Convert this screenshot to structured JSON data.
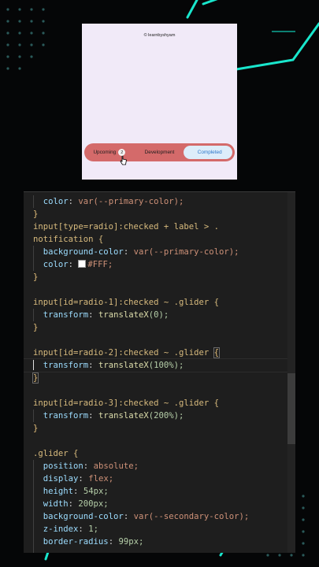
{
  "preview": {
    "brand": "© learnbyshyam",
    "tabs": [
      {
        "label": "Upcoming",
        "badge": "2"
      },
      {
        "label": "Development"
      },
      {
        "label": "Completed",
        "selected": true
      }
    ],
    "colors": {
      "bar": "#d46a6a",
      "glider": "#ddedfa",
      "background": "#f1eaf8"
    }
  },
  "code": {
    "l1_prop": "color",
    "l1_val": "var(--primary-color);",
    "l2": "}",
    "l3": "input[type=radio]:checked + label > .",
    "l4": "notification {",
    "l5_prop": "background-color",
    "l5_val": "var(--primary-color);",
    "l6_prop": "color",
    "l6_val": "#FFF;",
    "l7": "}",
    "l8": "input[id=radio-1]:checked ~ .glider {",
    "l9_prop": "transform",
    "l9_fn": "translateX",
    "l9_arg": "(0);",
    "l10": "}",
    "l11": "input[id=radio-2]:checked ~ .glider ",
    "l11_brace": "{",
    "l12_prop": "transform",
    "l12_fn": "translateX",
    "l12_arg": "(100%);",
    "l13": "}",
    "l14": "input[id=radio-3]:checked ~ .glider {",
    "l15_prop": "transform",
    "l15_fn": "translateX",
    "l15_arg": "(200%);",
    "l16": "}",
    "l17": ".glider {",
    "l18_prop": "position",
    "l18_val": "absolute;",
    "l19_prop": "display",
    "l19_val": "flex;",
    "l20_prop": "height",
    "l20_val": "54px;",
    "l21_prop": "width",
    "l21_val": "200px;",
    "l22_prop": "background-color",
    "l22_val": "var(--secondary-color);",
    "l23_prop": "z-index",
    "l23_val": "1;",
    "l24_prop": "border-radius",
    "l24_val": "99px;"
  }
}
